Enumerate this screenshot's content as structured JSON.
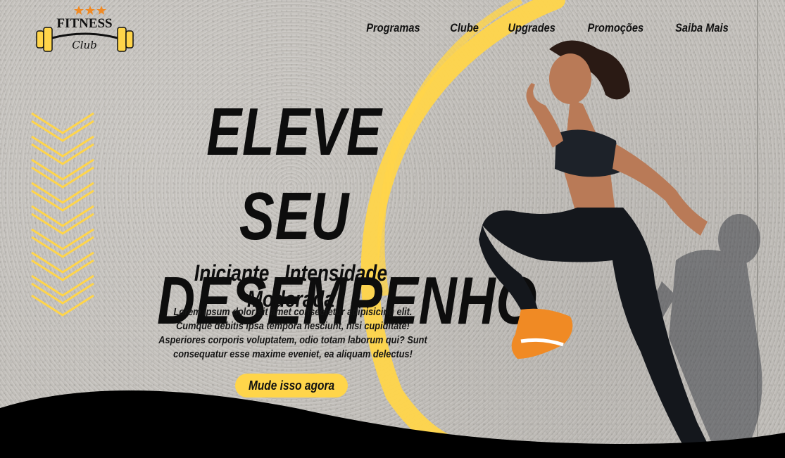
{
  "logo": {
    "top_text": "FITNESS",
    "script_text": "Club"
  },
  "nav": {
    "items": [
      {
        "label": "Programas"
      },
      {
        "label": "Clube"
      },
      {
        "label": "Upgrades"
      },
      {
        "label": "Promoções"
      },
      {
        "label": "Saiba Mais"
      }
    ]
  },
  "hero": {
    "headline_line1": "ELEVE SEU",
    "headline_line2": "DESEMPENHO",
    "subtitle": "Iniciante . Intensidade Moderada",
    "description": "Lorem ipsum dolor sit amet consectetur adipisicing elit. Cumque debitis ipsa tempora nesciunt, nisi cupiditate! Asperiores corporis voluptatem, odio totam laborum qui? Sunt consequatur esse maxime eveniet, ea aliquam delectus!",
    "cta_label": "Mude isso agora"
  },
  "colors": {
    "accent_yellow": "#ffd54a",
    "text_dark": "#0d0d0d",
    "wave_black": "#000000",
    "star_orange": "#f08a24"
  },
  "icons": [
    "dumbbell-icon",
    "star-icon",
    "chevron-down-icon"
  ]
}
